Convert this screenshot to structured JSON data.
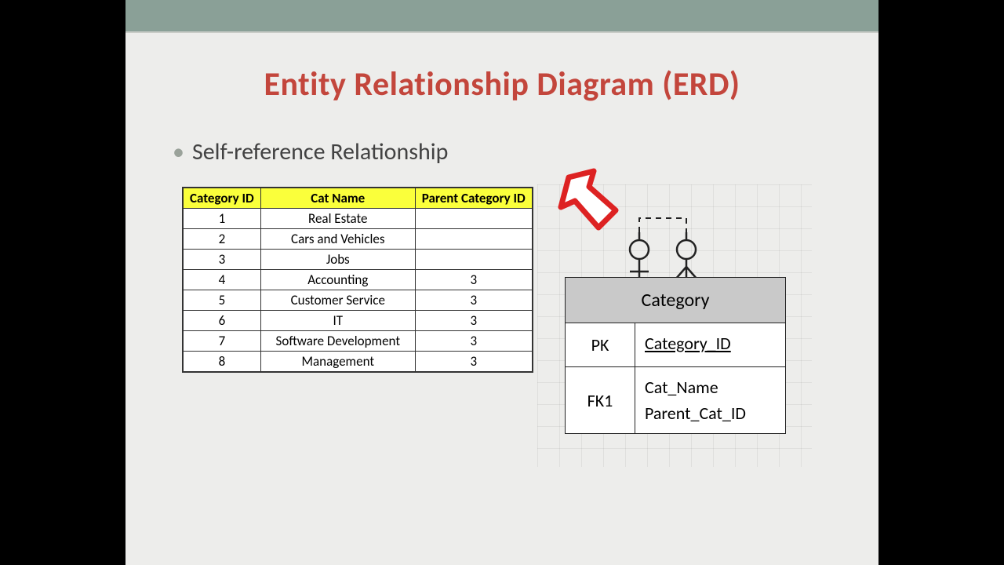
{
  "slide": {
    "title": "Entity Relationship Diagram (ERD)",
    "bullet": "Self-reference  Relationship"
  },
  "table": {
    "headers": [
      "Category ID",
      "Cat Name",
      "Parent Category ID"
    ],
    "rows": [
      [
        "1",
        "Real Estate",
        ""
      ],
      [
        "2",
        "Cars and Vehicles",
        ""
      ],
      [
        "3",
        "Jobs",
        ""
      ],
      [
        "4",
        "Accounting",
        "3"
      ],
      [
        "5",
        "Customer Service",
        "3"
      ],
      [
        "6",
        "IT",
        "3"
      ],
      [
        "7",
        "Software Development",
        "3"
      ],
      [
        "8",
        "Management",
        "3"
      ]
    ]
  },
  "entity": {
    "name": "Category",
    "pk_label": "PK",
    "pk_attr": "Category_ID",
    "fk_label": "FK1",
    "attrs": [
      "Cat_Name",
      "Parent_Cat_ID"
    ]
  }
}
